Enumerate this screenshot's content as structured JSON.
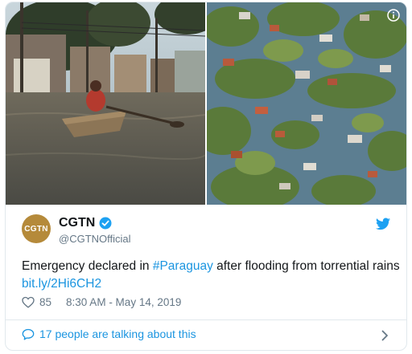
{
  "tweet": {
    "author_name": "CGTN",
    "author_handle": "@CGTNOfficial",
    "avatar_text": "CGTN",
    "text_before": "Emergency declared in ",
    "hashtag": "#Paraguay",
    "text_middle": " after flooding from torrential rains ",
    "link": "bit.ly/2Hi6CH2",
    "likes": "85",
    "timestamp": "8:30 AM - May 14, 2019"
  },
  "footer": {
    "talking_text": "17 people are talking about this"
  },
  "colors": {
    "link": "#1b95e0",
    "secondary_text": "#657786",
    "border": "#e1e8ed",
    "avatar": "#b58a3a"
  },
  "icons": [
    "info-icon",
    "verified-badge-icon",
    "twitter-bird-icon",
    "heart-icon",
    "speech-bubble-icon",
    "chevron-right-icon"
  ]
}
